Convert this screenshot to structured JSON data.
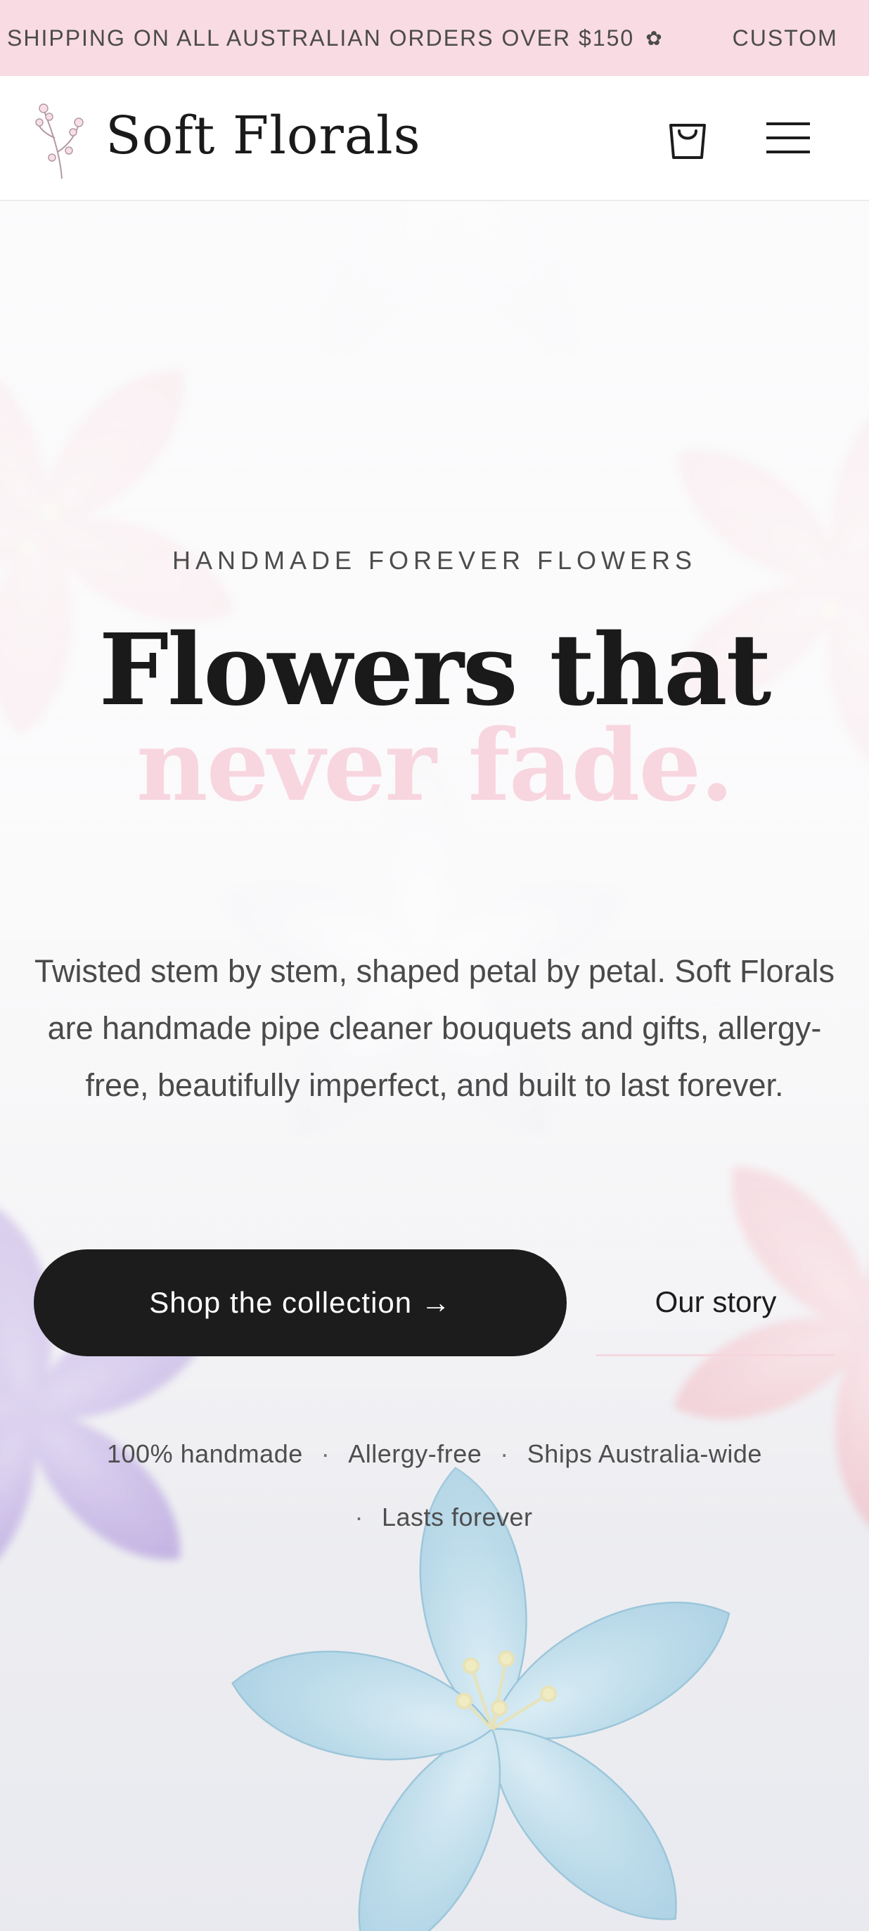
{
  "announcement": {
    "items": [
      "SHIPPING ON ALL AUSTRALIAN ORDERS OVER $150",
      "CUSTOM"
    ],
    "separator_icon": "flower-icon"
  },
  "header": {
    "brand_name": "Soft Florals",
    "logo_icon": "floral-sprig-icon",
    "cart_icon": "shopping-bag-icon",
    "menu_icon": "hamburger-menu-icon"
  },
  "hero": {
    "eyebrow": "HANDMADE FOREVER FLOWERS",
    "headline_line1": "Flowers that",
    "headline_line2": "never fade.",
    "description": "Twisted stem by stem, shaped petal by petal. Soft Florals are handmade pipe cleaner bouquets and gifts, allergy-free, beautifully imperfect, and built to last forever.",
    "primary_cta": "Shop the collection →",
    "secondary_cta": "Our story",
    "features": [
      "100% handmade",
      "Allergy-free",
      "Ships Australia-wide",
      "Lasts forever"
    ],
    "feature_separator": "·"
  },
  "colors": {
    "announcement_bg": "#f9dbe3",
    "accent_pink": "#f8d6df",
    "button_dark": "#1c1c1c",
    "text_dark": "#1a1a1a",
    "text_muted": "#4a4a4a",
    "flower_blue": "#bcdcea",
    "flower_lavender": "#c9b8e6",
    "flower_pink": "#f3c4cc"
  }
}
